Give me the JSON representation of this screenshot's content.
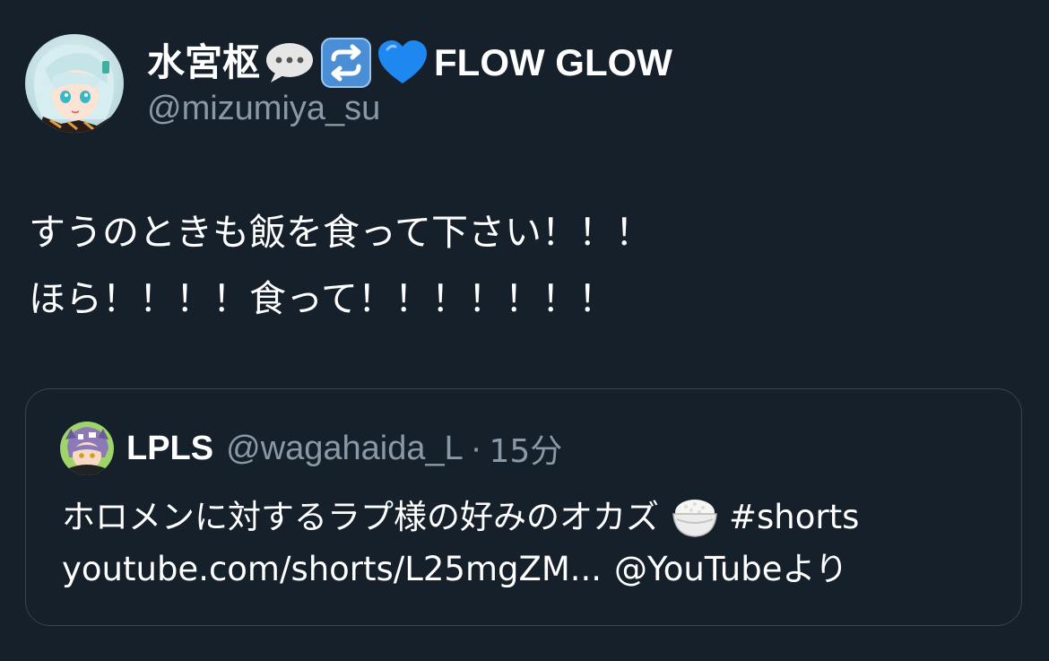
{
  "author": {
    "display_name": "水宮枢",
    "name_suffix": "FLOW GLOW",
    "handle": "@mizumiya_su",
    "name_icons": [
      "speech-bubble-icon",
      "repeat-icon",
      "blue-heart-icon"
    ]
  },
  "tweet": {
    "text_line1": "すうのときも飯を食って下さい！！！",
    "text_line2": "ほら！！！！食って！！！！！！！"
  },
  "quote": {
    "display_name": "LPLS",
    "handle": "@wagahaida_L",
    "separator": "·",
    "time": "15分",
    "text_main": "ホロメンに対するラプ様の好みのオカズ",
    "bowl_icon": "rice-bowl-icon",
    "hashtag": "#shorts",
    "link_text": "youtube.com/shorts/L25mgZM...",
    "via_text": "@YouTubeより"
  },
  "colors": {
    "background": "#15202b",
    "secondary_text": "#8b98a5",
    "border": "#38444d",
    "heart": "#1d9bf0"
  }
}
